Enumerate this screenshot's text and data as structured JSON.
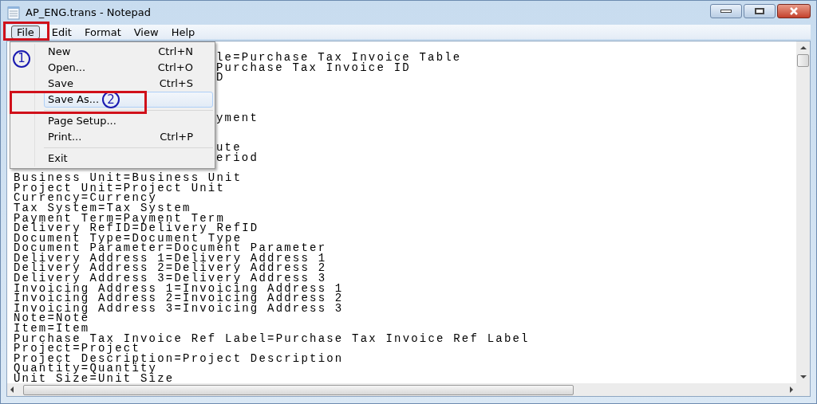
{
  "window": {
    "title": "AP_ENG.trans - Notepad"
  },
  "menubar": [
    {
      "label": "File",
      "selected": true
    },
    {
      "label": "Edit",
      "selected": false
    },
    {
      "label": "Format",
      "selected": false
    },
    {
      "label": "View",
      "selected": false
    },
    {
      "label": "Help",
      "selected": false
    }
  ],
  "file_menu": [
    {
      "kind": "item",
      "label": "New",
      "shortcut": "Ctrl+N",
      "selected": false
    },
    {
      "kind": "item",
      "label": "Open...",
      "shortcut": "Ctrl+O",
      "selected": false
    },
    {
      "kind": "item",
      "label": "Save",
      "shortcut": "Ctrl+S",
      "selected": false
    },
    {
      "kind": "item",
      "label": "Save As...",
      "selected": true
    },
    {
      "kind": "separator"
    },
    {
      "kind": "item",
      "label": "Page Setup...",
      "selected": false
    },
    {
      "kind": "item",
      "label": "Print...",
      "shortcut": "Ctrl+P",
      "selected": false
    },
    {
      "kind": "separator"
    },
    {
      "kind": "item",
      "label": "Exit",
      "selected": false
    }
  ],
  "annotations": [
    {
      "number": "1"
    },
    {
      "number": "2"
    }
  ],
  "editor_lines": [
    {
      "kind": "partial",
      "text": "le=Purchase Tax Invoice Table"
    },
    {
      "kind": "partial",
      "text": "Purchase Tax Invoice ID"
    },
    {
      "kind": "partial",
      "text": "D"
    },
    {
      "kind": "hidden"
    },
    {
      "kind": "hidden"
    },
    {
      "kind": "hidden"
    },
    {
      "kind": "partial",
      "text": "yment"
    },
    {
      "kind": "hidden"
    },
    {
      "kind": "hidden"
    },
    {
      "kind": "partial",
      "text": "ute"
    },
    {
      "kind": "partial",
      "text": "eriod"
    },
    {
      "kind": "hidden"
    },
    {
      "kind": "full",
      "text": "Business Unit=Business Unit"
    },
    {
      "kind": "full",
      "text": "Project Unit=Project Unit"
    },
    {
      "kind": "full",
      "text": "Currency=Currency"
    },
    {
      "kind": "full",
      "text": "Tax System=Tax System"
    },
    {
      "kind": "full",
      "text": "Payment Term=Payment Term"
    },
    {
      "kind": "full",
      "text": "Delivery RefID=Delivery RefID"
    },
    {
      "kind": "full",
      "text": "Document Type=Document Type"
    },
    {
      "kind": "full",
      "text": "Document Parameter=Document Parameter"
    },
    {
      "kind": "full",
      "text": "Delivery Address 1=Delivery Address 1"
    },
    {
      "kind": "full",
      "text": "Delivery Address 2=Delivery Address 2"
    },
    {
      "kind": "full",
      "text": "Delivery Address 3=Delivery Address 3"
    },
    {
      "kind": "full",
      "text": "Invoicing Address 1=Invoicing Address 1"
    },
    {
      "kind": "full",
      "text": "Invoicing Address 2=Invoicing Address 2"
    },
    {
      "kind": "full",
      "text": "Invoicing Address 3=Invoicing Address 3"
    },
    {
      "kind": "full",
      "text": "Note=Note"
    },
    {
      "kind": "full",
      "text": "Item=Item"
    },
    {
      "kind": "full",
      "text": "Purchase Tax Invoice Ref Label=Purchase Tax Invoice Ref Label"
    },
    {
      "kind": "full",
      "text": "Project=Project"
    },
    {
      "kind": "full",
      "text": "Project Description=Project Description"
    },
    {
      "kind": "full",
      "text": "Quantity=Quantity"
    },
    {
      "kind": "full",
      "text": "Unit Size=Unit Size"
    }
  ]
}
